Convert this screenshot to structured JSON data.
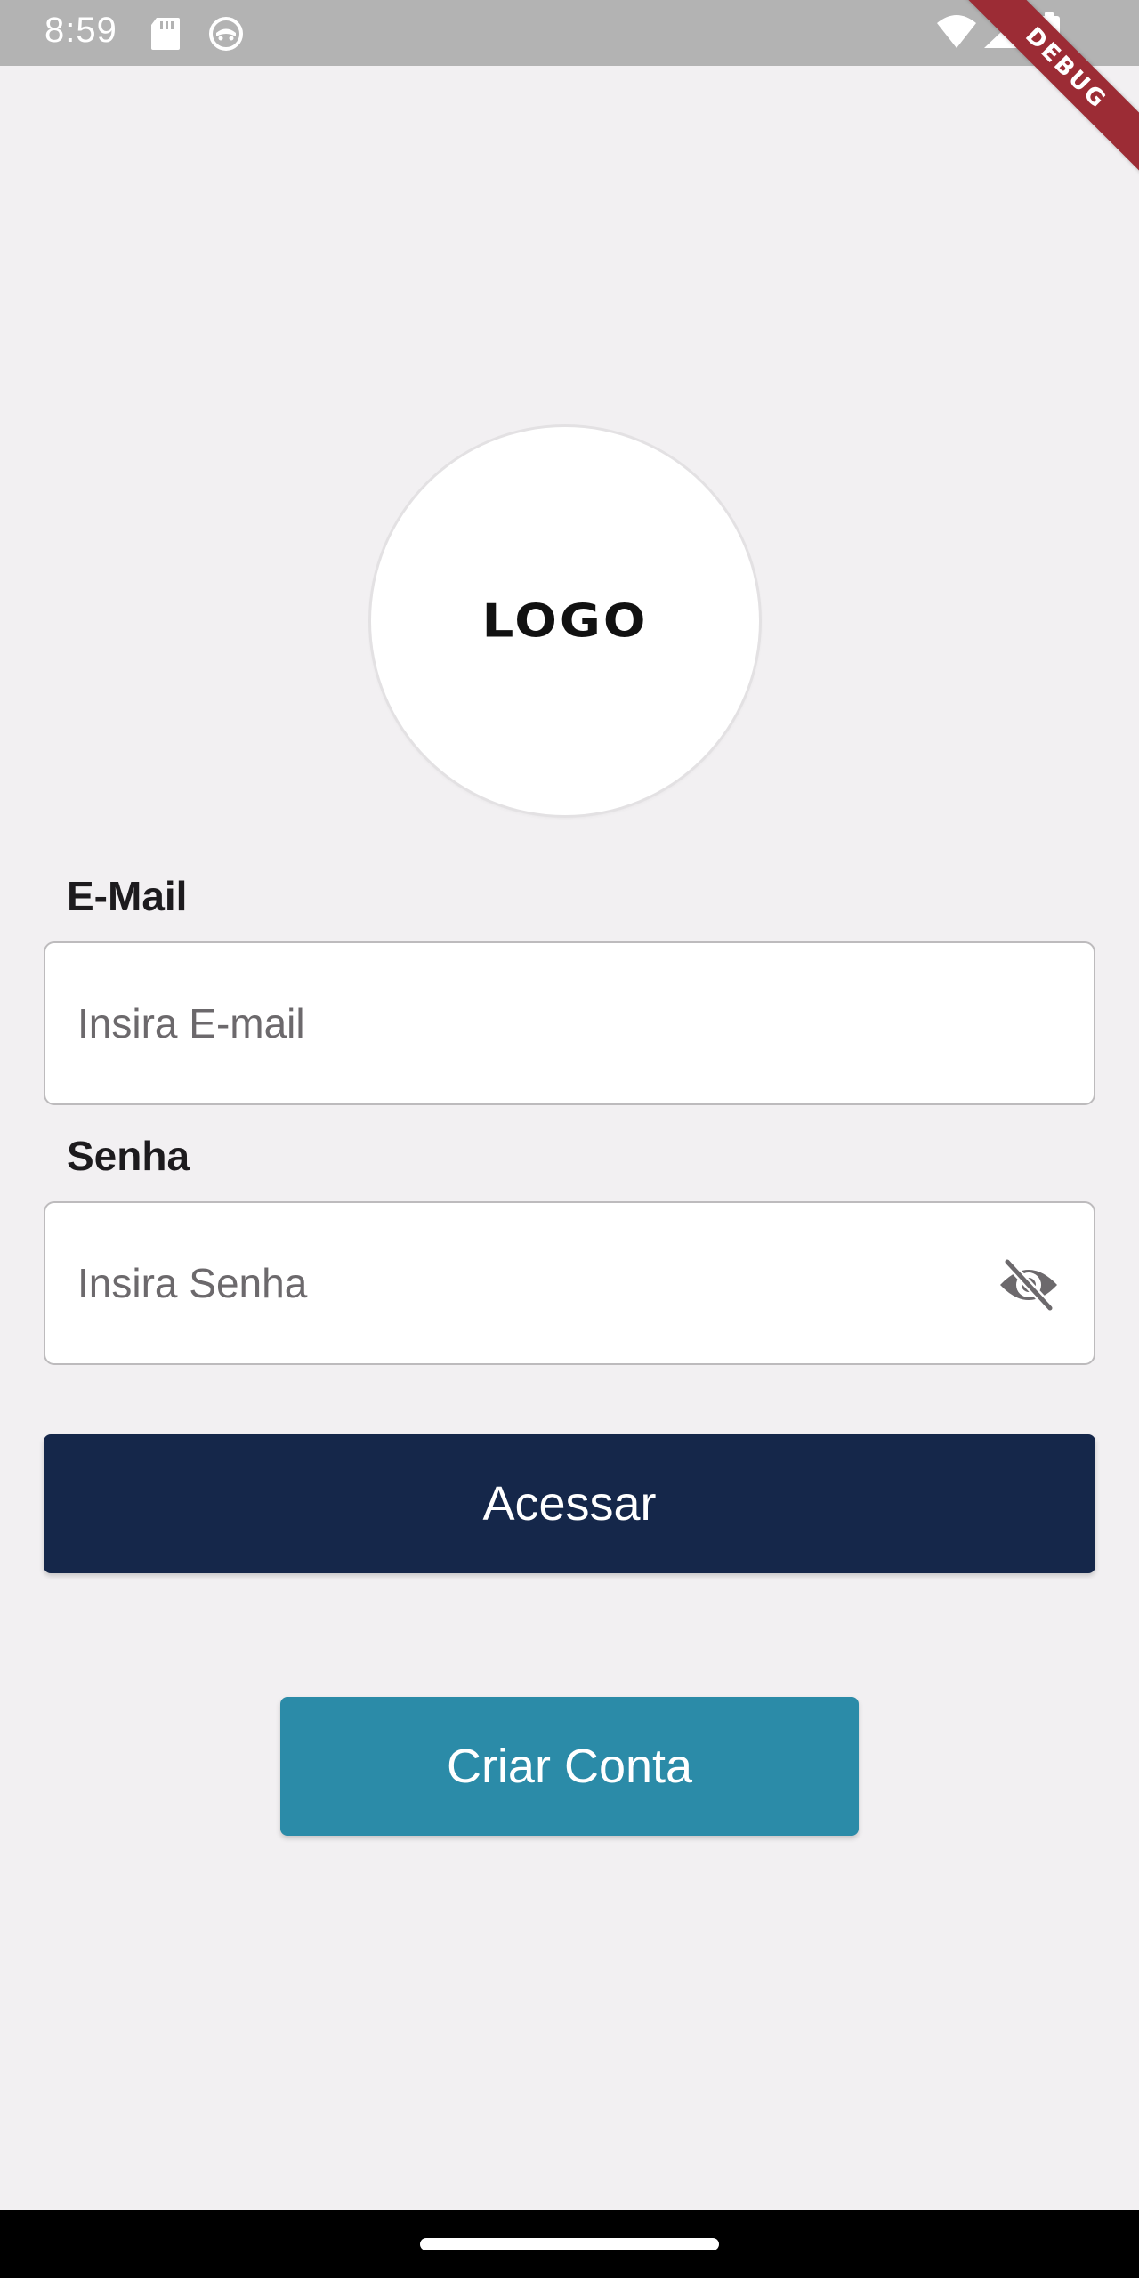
{
  "status_bar": {
    "time": "8:59",
    "icons": [
      "sd-card-icon",
      "face-icon",
      "wifi-icon",
      "signal-icon",
      "battery-icon"
    ]
  },
  "debug_banner": {
    "label": "DEBUG"
  },
  "logo": {
    "text": "LOGO"
  },
  "form": {
    "email": {
      "label": "E-Mail",
      "value": "",
      "placeholder": "Insira E-mail"
    },
    "password": {
      "label": "Senha",
      "value": "",
      "placeholder": "Insira Senha",
      "visibility_icon": "visibility-off-icon"
    }
  },
  "actions": {
    "login_label": "Acessar",
    "create_account_label": "Criar Conta"
  },
  "colors": {
    "background": "#f2f0f2",
    "status_bar": "#b3b3b3",
    "primary_button": "#15274a",
    "secondary_button": "#2b8ba8",
    "debug_ribbon": "#9c2c35"
  }
}
